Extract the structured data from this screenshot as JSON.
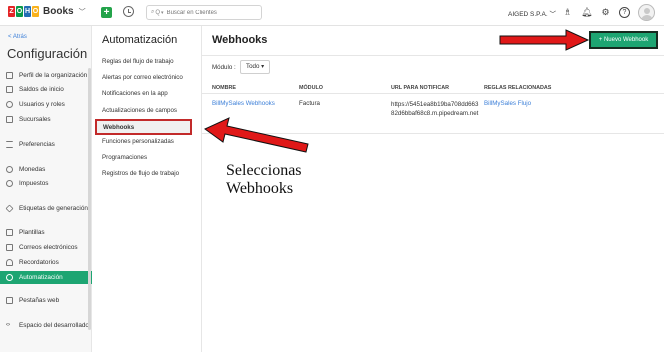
{
  "header": {
    "brand_letters": [
      "Z",
      "O",
      "H",
      "O"
    ],
    "brand_colors": [
      "#e42527",
      "#089949",
      "#226db4",
      "#f9b21d"
    ],
    "brand_name": "Books",
    "search_scope": "Q",
    "search_placeholder": "Buscar en Clientes",
    "org_name": "AIGED S.P.A.",
    "icons": [
      "plus-icon",
      "history-icon",
      "search-icon",
      "subscription-icon",
      "bell-icon",
      "gear-icon",
      "help-icon",
      "avatar"
    ]
  },
  "sidebar": {
    "back_label": "< Atrás",
    "title": "Configuración",
    "items": [
      {
        "label": "Perfil de la organización",
        "icon": "building-icon"
      },
      {
        "label": "Saldos de inicio",
        "icon": "balance-icon"
      },
      {
        "label": "Usuarios y roles",
        "icon": "users-icon"
      },
      {
        "label": "Sucursales",
        "icon": "branch-icon"
      },
      {
        "label": "Preferencias",
        "icon": "sliders-icon"
      },
      {
        "label": "Monedas",
        "icon": "coins-icon"
      },
      {
        "label": "Impuestos",
        "icon": "tax-icon"
      },
      {
        "label": "Etiquetas de generación",
        "icon": "tag-icon"
      },
      {
        "label": "Plantillas",
        "icon": "template-icon"
      },
      {
        "label": "Correos electrónicos",
        "icon": "mail-icon"
      },
      {
        "label": "Recordatorios",
        "icon": "reminder-icon"
      },
      {
        "label": "Automatización",
        "icon": "automation-icon",
        "active": true
      },
      {
        "label": "Pestañas web",
        "icon": "webtab-icon"
      },
      {
        "label": "Espacio del desarrollado",
        "icon": "code-icon"
      }
    ]
  },
  "submenu": {
    "title": "Automatización",
    "items": [
      "Reglas del flujo de trabajo",
      "Alertas por correo electrónico",
      "Notificaciones en la app",
      "Actualizaciones de campos",
      "Webhooks",
      "Funciones personalizadas",
      "Programaciones",
      "Registros de flujo de trabajo"
    ],
    "active_index": 4
  },
  "main": {
    "title": "Webhooks",
    "new_button": "+ Nuevo Webhook",
    "module_label": "Módulo :",
    "module_value": "Todo ▾",
    "columns": [
      "NOMBRE",
      "MÓDULO",
      "URL PARA NOTIFICAR",
      "REGLAS RELACIONADAS"
    ],
    "rows": [
      {
        "name": "BillMySales Webhooks",
        "module": "Factura",
        "url": "https://5451ea8b19ba708dd66382d6bbaf68c8.m.pipedream.net",
        "rules": "BillMySales Flujo"
      }
    ]
  },
  "annotation": {
    "line1": "Seleccionas",
    "line2": "Webhooks",
    "arrow_color": "#e01818"
  }
}
